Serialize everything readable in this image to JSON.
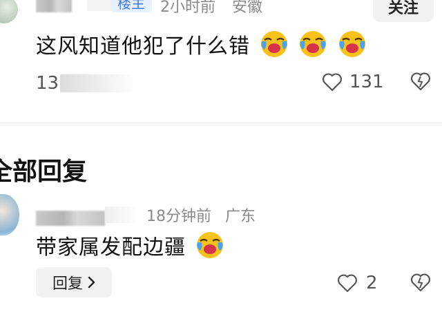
{
  "top_comment": {
    "author_badge": "楼主",
    "time": "2小时前",
    "location": "安徽",
    "follow_label": "关注",
    "text": "这风知道他犯了什么错",
    "emoji_name": "laughing-crying-emoji",
    "reply_count_visible": "13",
    "like_count": "131"
  },
  "section": {
    "title": "全部回复"
  },
  "reply_comment": {
    "time": "18分钟前",
    "location": "广东",
    "text": "带家属发配边疆",
    "emoji_name": "laughing-crying-emoji",
    "reply_button_label": "回复",
    "like_count": "2"
  },
  "icons": {
    "like": "heart-outline-icon",
    "dislike": "broken-heart-icon",
    "chevron": "chevron-right-icon"
  },
  "colors": {
    "emoji_face": "#f7c21a",
    "emoji_tears": "#4aa3f0",
    "emoji_mouth": "#d8334a",
    "badge_bg": "#e8f1ff",
    "badge_text": "#3b7cf5"
  }
}
